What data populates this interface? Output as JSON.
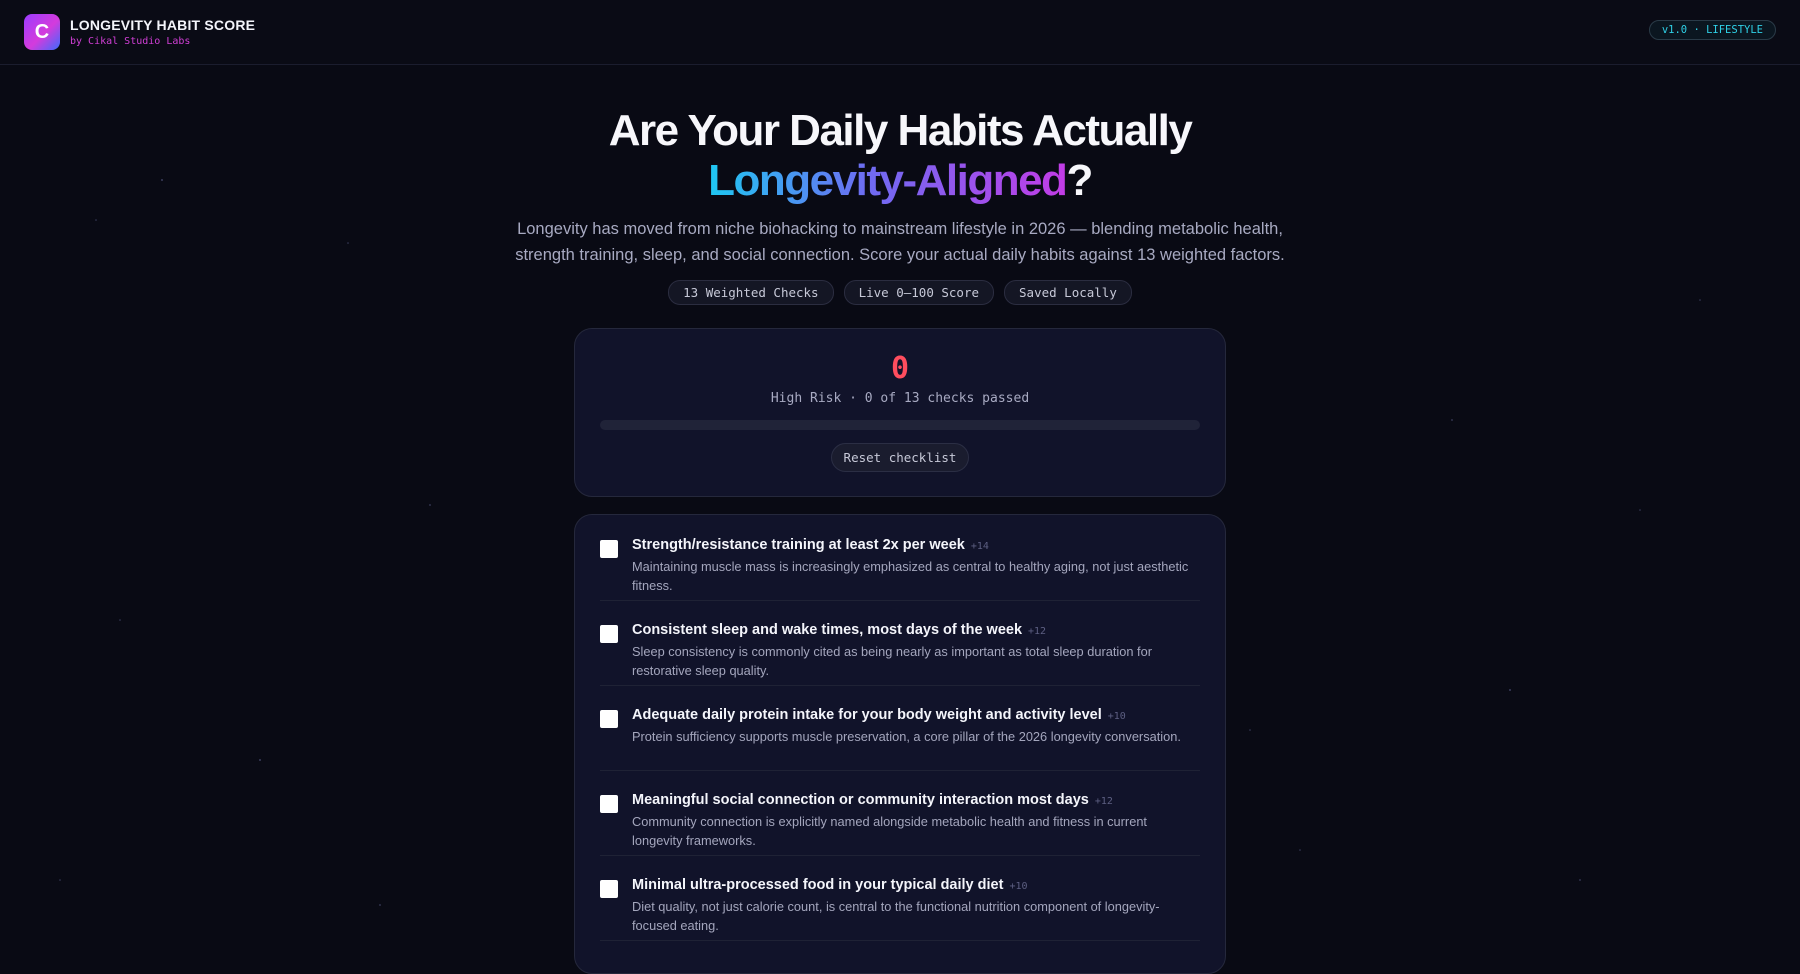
{
  "header": {
    "logo_letter": "C",
    "title": "LONGEVITY HABIT SCORE",
    "subtitle": "by Cikal Studio Labs",
    "version_badge": "v1.0 · LIFESTYLE"
  },
  "hero": {
    "title_line1": "Are Your Daily Habits Actually",
    "title_highlight": "Longevity-Aligned",
    "title_suffix": "?",
    "description": "Longevity has moved from niche biohacking to mainstream lifestyle in 2026 — blending metabolic health, strength training, sleep, and social connection. Score your actual daily habits against 13 weighted factors.",
    "tags": [
      "13 Weighted Checks",
      "Live 0–100 Score",
      "Saved Locally"
    ]
  },
  "score": {
    "value": "0",
    "status": "High Risk · 0 of 13 checks passed",
    "progress_fraction": 0,
    "reset_label": "Reset checklist",
    "score_color": "#ff4d5e"
  },
  "checklist": {
    "items": [
      {
        "title": "Strength/resistance training at least 2x per week",
        "weight": "+14",
        "description": "Maintaining muscle mass is increasingly emphasized as central to healthy aging, not just aesthetic fitness.",
        "checked": false
      },
      {
        "title": "Consistent sleep and wake times, most days of the week",
        "weight": "+12",
        "description": "Sleep consistency is commonly cited as being nearly as important as total sleep duration for restorative sleep quality.",
        "checked": false
      },
      {
        "title": "Adequate daily protein intake for your body weight and activity level",
        "weight": "+10",
        "description": "Protein sufficiency supports muscle preservation, a core pillar of the 2026 longevity conversation.",
        "checked": false
      },
      {
        "title": "Meaningful social connection or community interaction most days",
        "weight": "+12",
        "description": "Community connection is explicitly named alongside metabolic health and fitness in current longevity frameworks.",
        "checked": false
      },
      {
        "title": "Minimal ultra-processed food in your typical daily diet",
        "weight": "+10",
        "description": "Diet quality, not just calorie count, is central to the functional nutrition component of longevity-focused eating.",
        "checked": false
      }
    ]
  },
  "colors": {
    "background": "#090a14",
    "accent_cyan": "#2fd0e6",
    "accent_magenta": "#d13fd6",
    "danger": "#ff4d5e"
  }
}
